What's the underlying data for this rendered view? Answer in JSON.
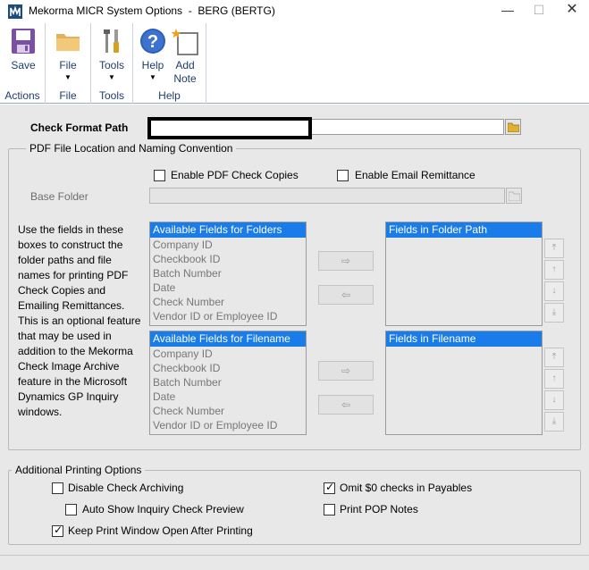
{
  "window": {
    "title": "Mekorma MICR System Options  -  BERG (BERTG)",
    "minimize": "—",
    "maximize": "☐",
    "close": "✕"
  },
  "ribbon": {
    "groups": [
      {
        "label": "Actions",
        "buttons": [
          {
            "label": "Save",
            "icon": "save-icon"
          }
        ]
      },
      {
        "label": "File",
        "buttons": [
          {
            "label": "File",
            "icon": "folder-icon",
            "dropdown": "▼"
          }
        ]
      },
      {
        "label": "Tools",
        "buttons": [
          {
            "label": "Tools",
            "icon": "tools-icon",
            "dropdown": "▼"
          }
        ]
      },
      {
        "label": "Help",
        "buttons": [
          {
            "label": "Help",
            "icon": "help-icon",
            "dropdown": "▼"
          },
          {
            "label": "Add\nNote",
            "icon": "add-note-icon"
          }
        ]
      }
    ]
  },
  "form": {
    "check_format_path": {
      "label": "Check Format Path",
      "value": ""
    },
    "pdf_group": {
      "title": "PDF File Location and Naming Convention",
      "enable_pdf": {
        "label": "Enable PDF Check Copies",
        "checked": false
      },
      "enable_email": {
        "label": "Enable Email Remittance",
        "checked": false
      },
      "base_folder": {
        "label": "Base Folder",
        "value": ""
      },
      "help_text": "Use the fields in these boxes to construct the folder paths and file names for printing PDF Check Copies and Emailing Remittances. This is an optional feature that may be used in addition to the Mekorma Check Image Archive feature in the Microsoft Dynamics GP Inquiry windows.",
      "available_folders": {
        "header": "Available Fields for Folders",
        "items": [
          "Company ID",
          "Checkbook ID",
          "Batch Number",
          "Date",
          "Check Number",
          "Vendor ID or Employee ID"
        ]
      },
      "folder_path": {
        "header": "Fields in Folder Path",
        "items": []
      },
      "available_filename": {
        "header": "Available Fields for Filename",
        "items": [
          "Company ID",
          "Checkbook ID",
          "Batch Number",
          "Date",
          "Check Number",
          "Vendor ID or Employee ID"
        ]
      },
      "filename": {
        "header": "Fields in Filename",
        "items": []
      },
      "move_right": "⇨",
      "move_left": "⇦",
      "order_top": "⤒",
      "order_up": "↑",
      "order_down": "↓",
      "order_bottom": "⤓"
    },
    "additional_group": {
      "title": "Additional Printing Options",
      "disable_archiving": {
        "label": "Disable Check Archiving",
        "checked": false
      },
      "auto_show": {
        "label": "Auto Show Inquiry Check Preview",
        "checked": false
      },
      "keep_open": {
        "label": "Keep Print Window Open After Printing",
        "checked": true
      },
      "omit_zero": {
        "label": "Omit $0 checks in Payables",
        "checked": true
      },
      "print_pop": {
        "label": "Print POP Notes",
        "checked": false
      }
    }
  },
  "colors": {
    "list_header": "#1a7ce8",
    "ribbon_text": "#1e3c6e",
    "window_bg": "#e8e8e8"
  }
}
